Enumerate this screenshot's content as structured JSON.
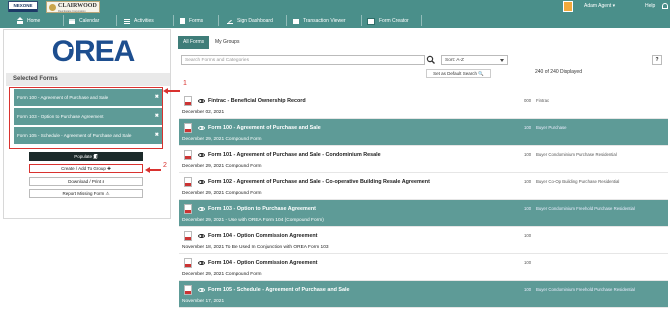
{
  "brand": {
    "nexone": "NEXONE",
    "clairwood": "CLAIRWOOD",
    "clairwood_tagline": "Real Estate Corporation",
    "orea": "OREA"
  },
  "nav": {
    "home": "Home",
    "calendar": "Calendar",
    "activities": "Activities",
    "forms": "Forms",
    "sign_dashboard": "Sign Dashboard",
    "transaction_viewer": "Transaction Viewer",
    "form_creator": "Form Creator",
    "agent": "Adam Agent ▾",
    "help": "Help"
  },
  "left_panel": {
    "selected_title": "Selected Forms",
    "selected_items": [
      {
        "label": "Form 100 - Agreement of Purchase and Sale",
        "close": "✖"
      },
      {
        "label": "Form 103 - Option to Purchase Agreement",
        "close": "✖"
      },
      {
        "label": "Form 105 - Schedule - Agreement of Purchase and Sale",
        "close": "✖"
      }
    ],
    "populate": "Populate 🗐",
    "create_add": "Create / Add To Group ✚",
    "download_print": "Download / Print ⭳",
    "report_missing": "Report Missing Form ⚠",
    "annotation_1": "1",
    "annotation_2": "2"
  },
  "right_panel": {
    "tabs": [
      "All Forms",
      "My Groups"
    ],
    "search_placeholder": "Search Forms and Categories",
    "sort_label": "Sort: A-Z",
    "default_search_btn": "Set as Default Search 🔍",
    "displayed": "240 of 240 Displayed",
    "help": "?"
  },
  "forms": [
    {
      "title": "Fintrac - Beneficial Ownership Record",
      "sub": "December 02, 2021",
      "num": "000",
      "tags": "Fintrac",
      "highlight": false
    },
    {
      "title": "Form 100 - Agreement of Purchase and Sale",
      "sub": "December 29, 2021    Compound Form",
      "num": "100",
      "tags": "Buyer   Purchase",
      "highlight": true
    },
    {
      "title": "Form 101 - Agreement of Purchase and Sale - Condominium Resale",
      "sub": "December 29, 2021    Compound Form",
      "num": "100",
      "tags": "Buyer   Condominium   Purchase   Residential",
      "highlight": false
    },
    {
      "title": "Form 102 - Agreement of Purchase and Sale - Co-operative Building Resale Agreement",
      "sub": "December 29, 2021    Compound Form",
      "num": "100",
      "tags": "Buyer   Co-Op Building   Purchase   Residential",
      "highlight": false
    },
    {
      "title": "Form 103 - Option to Purchase Agreement",
      "sub": "December 29, 2021    - Use with OREA Form 104 (Compound Form)",
      "num": "100",
      "tags": "Buyer   Condominium   Freehold   Purchase   Residential",
      "highlight": true
    },
    {
      "title": "Form 104 - Option Commission Agreement",
      "sub": "November 18, 2021    To Be Used In Conjunction with OREA Form 103",
      "num": "100",
      "tags": "",
      "highlight": false
    },
    {
      "title": "Form 104 - Option Commission Agreement",
      "sub": "December 29, 2021    Compound Form",
      "num": "100",
      "tags": "",
      "highlight": false
    },
    {
      "title": "Form 105 - Schedule - Agreement of Purchase and Sale",
      "sub": "November 17, 2021",
      "num": "100",
      "tags": "Buyer   Condominium   Freehold   Purchase   Residential",
      "highlight": true
    }
  ],
  "colors": {
    "nav_bg": "#4a8f8a",
    "highlight_row": "#5e9b97",
    "annotation_red": "#d9322f",
    "orea_blue": "#1d4e8f"
  }
}
